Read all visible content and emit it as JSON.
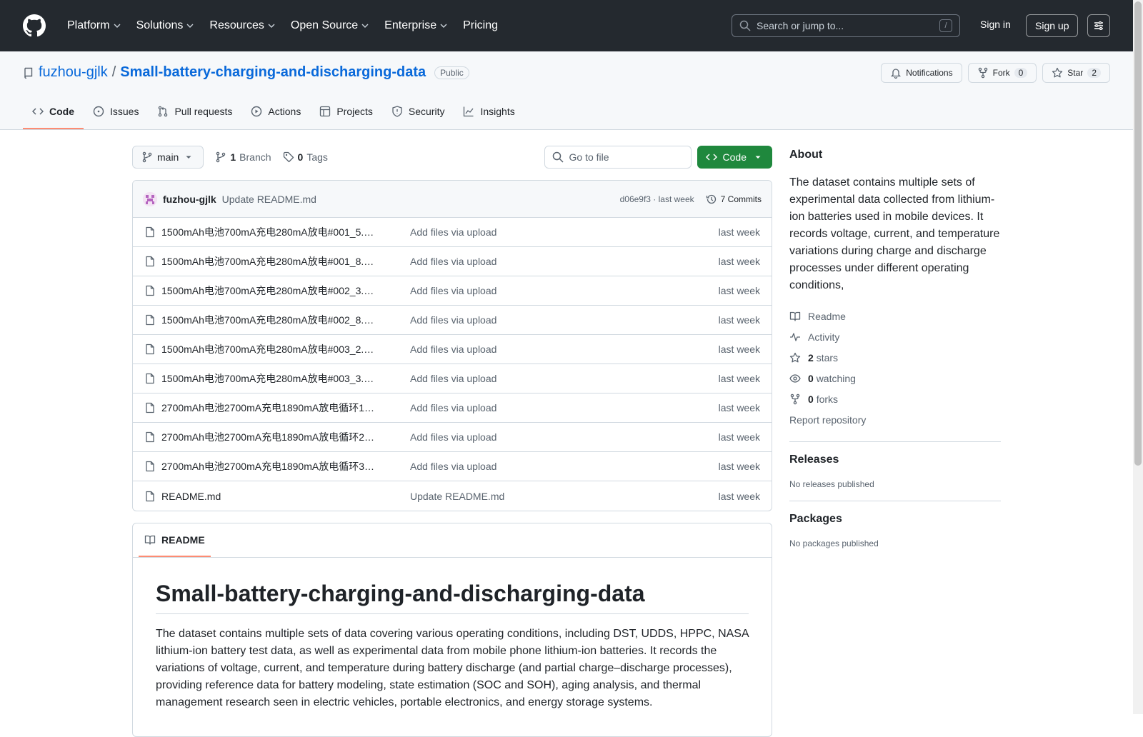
{
  "header": {
    "nav": [
      "Platform",
      "Solutions",
      "Resources",
      "Open Source",
      "Enterprise",
      "Pricing"
    ],
    "search_placeholder": "Search or jump to...",
    "search_key": "/",
    "sign_in": "Sign in",
    "sign_up": "Sign up"
  },
  "repo": {
    "owner": "fuzhou-gjlk",
    "separator": "/",
    "name": "Small-battery-charging-and-discharging-data",
    "visibility": "Public",
    "notifications_label": "Notifications",
    "fork_label": "Fork",
    "fork_count": "0",
    "star_label": "Star",
    "star_count": "2"
  },
  "tabs": [
    "Code",
    "Issues",
    "Pull requests",
    "Actions",
    "Projects",
    "Security",
    "Insights"
  ],
  "toolbar": {
    "branch": "main",
    "branch_count": "1",
    "branch_label": "Branch",
    "tag_count": "0",
    "tag_label": "Tags",
    "go_to_file": "Go to file",
    "code_button": "Code"
  },
  "commit": {
    "author": "fuzhou-gjlk",
    "message": "Update README.md",
    "meta": "d06e9f3 · last week",
    "commits": "7 Commits"
  },
  "files": [
    {
      "name": "1500mAh电池700mA充电280mA放电#001_5.…",
      "message": "Add files via upload",
      "date": "last week"
    },
    {
      "name": "1500mAh电池700mA充电280mA放电#001_8.…",
      "message": "Add files via upload",
      "date": "last week"
    },
    {
      "name": "1500mAh电池700mA充电280mA放电#002_3.…",
      "message": "Add files via upload",
      "date": "last week"
    },
    {
      "name": "1500mAh电池700mA充电280mA放电#002_8.…",
      "message": "Add files via upload",
      "date": "last week"
    },
    {
      "name": "1500mAh电池700mA充电280mA放电#003_2.…",
      "message": "Add files via upload",
      "date": "last week"
    },
    {
      "name": "1500mAh电池700mA充电280mA放电#003_3.…",
      "message": "Add files via upload",
      "date": "last week"
    },
    {
      "name": "2700mAh电池2700mA充电1890mA放电循环1…",
      "message": "Add files via upload",
      "date": "last week"
    },
    {
      "name": "2700mAh电池2700mA充电1890mA放电循环2…",
      "message": "Add files via upload",
      "date": "last week"
    },
    {
      "name": "2700mAh电池2700mA充电1890mA放电循环3…",
      "message": "Add files via upload",
      "date": "last week"
    },
    {
      "name": "README.md",
      "message": "Update README.md",
      "date": "last week"
    }
  ],
  "readme": {
    "tab": "README",
    "title": "Small-battery-charging-and-discharging-data",
    "body": "The dataset contains multiple sets of data covering various operating conditions, including DST, UDDS, HPPC, NASA lithium-ion battery test data, as well as experimental data from mobile phone lithium-ion batteries. It records the variations of voltage, current, and temperature during battery discharge (and partial charge–discharge processes), providing reference data for battery modeling, state estimation (SOC and SOH), aging analysis, and thermal management research seen in electric vehicles, portable electronics, and energy storage systems."
  },
  "sidebar": {
    "about_heading": "About",
    "description": "The dataset contains multiple sets of experimental data collected from lithium-ion batteries used in mobile devices. It records voltage, current, and temperature variations during charge and discharge processes under different operating conditions,",
    "readme": "Readme",
    "activity": "Activity",
    "stars_count": "2",
    "stars_label": "stars",
    "watching_count": "0",
    "watching_label": "watching",
    "forks_count": "0",
    "forks_label": "forks",
    "report": "Report repository",
    "releases_heading": "Releases",
    "releases_text": "No releases published",
    "packages_heading": "Packages",
    "packages_text": "No packages published"
  },
  "colors": {
    "header_bg": "#24292f",
    "link": "#0969da",
    "code_button": "#1f883d",
    "tab_underline": "#fd8c73"
  }
}
